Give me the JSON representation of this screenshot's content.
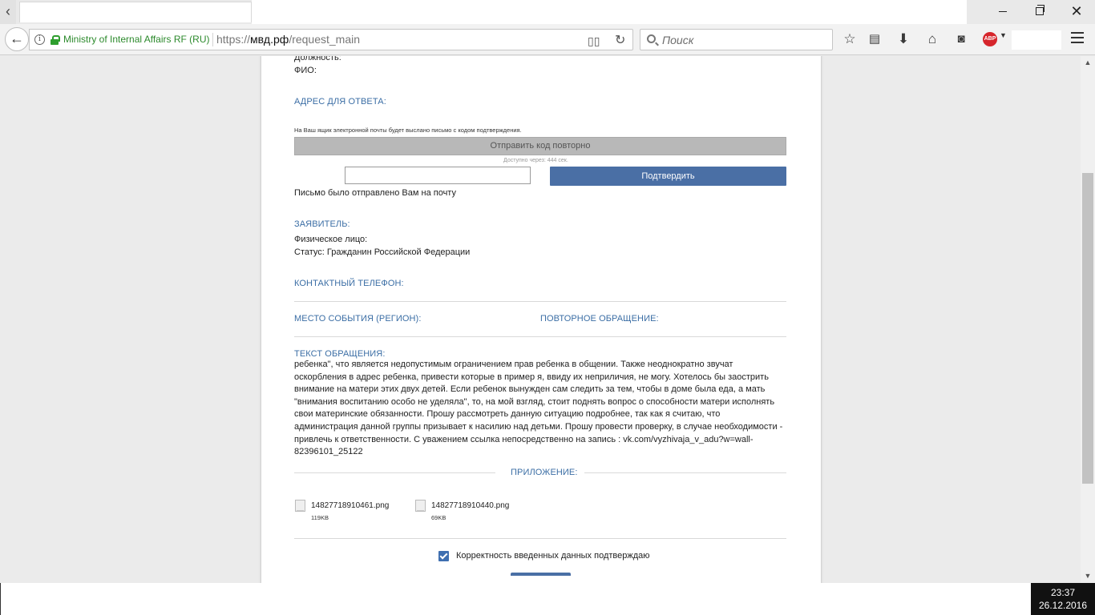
{
  "browser": {
    "nav_back_glyph": "‹",
    "org_name": "Ministry of Internal Affairs RF (RU)",
    "url_scheme": "https://",
    "url_domain": "мвд.рф",
    "url_path": "/request_main",
    "search_placeholder": "Поиск",
    "abp_label": "ABP"
  },
  "form": {
    "position_label": "Должность:",
    "fio_label": "ФИО:",
    "reply_address_heading": "АДРЕС ДЛЯ ОТВЕТА:",
    "email_notice": "На Ваш ящик электронной почты будет выслано письмо с кодом подтверждения.",
    "resend_button": "Отправить код повторно",
    "available_in": "Доступно через: 444 сек.",
    "confirm_button": "Подтвердить",
    "mail_sent": "Письмо было отправлено Вам на почту",
    "applicant_heading": "ЗАЯВИТЕЛЬ:",
    "person_type": "Физическое лицо:",
    "status": "Статус: Гражданин Российской Федерации",
    "phone_heading": "КОНТАКТНЫЙ ТЕЛЕФОН:",
    "event_place_heading": "МЕСТО СОБЫТИЯ (РЕГИОН):",
    "repeat_request_heading": "ПОВТОРНОЕ ОБРАЩЕНИЕ:",
    "request_text_heading": "ТЕКСТ ОБРАЩЕНИЯ:",
    "request_text": "ребенка\", что является недопустимым ограничением прав ребенка в общении. Также неоднократно звучат оскорбления в адрес ребенка, привести которые в пример я, ввиду их неприличия, не могу. Хотелось бы заострить внимание на матери этих двух детей. Если ребенок вынужден сам следить за тем, чтобы в доме была еда, а мать \"внимания воспитанию особо не уделяла\", то, на мой взгляд, стоит поднять вопрос о способности матери исполнять свои материнские обязанности. Прошу рассмотреть данную ситуацию подробнее, так как я считаю, что администрация данной группы призывает к насилию над детьми. Прошу провести проверку, в случае необходимости - привлечь к ответственности. С уважением ссылка непосредственно на запись : vk.com/vyzhivaja_v_adu?w=wall-82396101_25122",
    "attachments_heading": "ПРИЛОЖЕНИЕ:",
    "attachments": [
      {
        "name": "14827718910461.png",
        "size": "119KB"
      },
      {
        "name": "14827718910440.png",
        "size": "69KB"
      }
    ],
    "confirm_checkbox_label": "Корректность введенных данных подтверждаю"
  },
  "taskbar": {
    "time": "23:37",
    "date": "26.12.2016"
  },
  "colors": {
    "accent_blue": "#4a6fa5",
    "section_heading": "#3b6ea5",
    "secure_green": "#2c8a2c"
  }
}
